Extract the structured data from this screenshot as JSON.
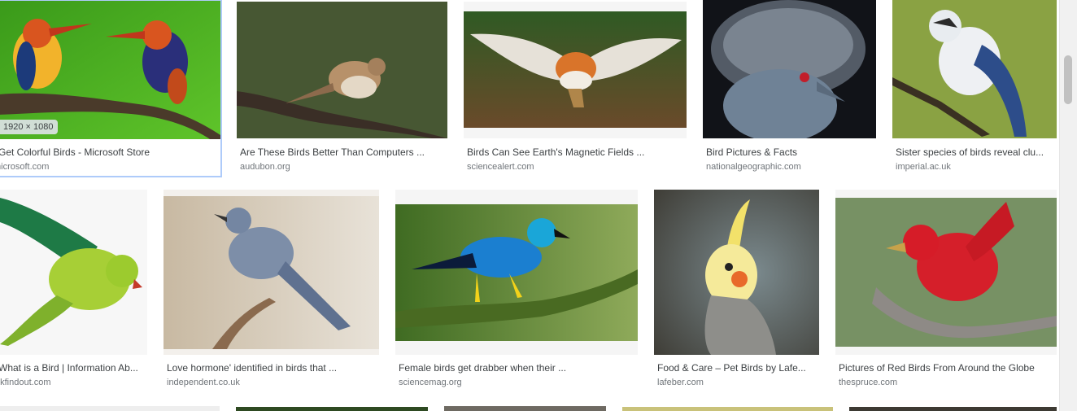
{
  "results": [
    {
      "caption": "Get Colorful Birds - Microsoft Store",
      "source": "microsoft.com",
      "dimensions": "1920 × 1080",
      "image_alt": "kingfisher-pair-photo"
    },
    {
      "caption": "Are These Birds Better Than Computers ...",
      "source": "audubon.org",
      "image_alt": "thrush-on-branch-photo"
    },
    {
      "caption": "Birds Can See Earth's Magnetic Fields ...",
      "source": "sciencealert.com",
      "image_alt": "robin-in-flight-photo"
    },
    {
      "caption": "Bird Pictures & Facts",
      "source": "nationalgeographic.com",
      "image_alt": "crowned-pigeon-photo"
    },
    {
      "caption": "Sister species of birds reveal clu...",
      "source": "imperial.ac.uk",
      "image_alt": "blue-white-bird-photo"
    },
    {
      "caption": "What is a Bird | Information Ab...",
      "source": "dkfindout.com",
      "image_alt": "green-parrot-photo"
    },
    {
      "caption": "Love hormone' identified in birds that ...",
      "source": "independent.co.uk",
      "image_alt": "grey-blue-bird-photo"
    },
    {
      "caption": "Female birds get drabber when their ...",
      "source": "sciencemag.org",
      "image_alt": "blue-honeycreeper-photo"
    },
    {
      "caption": "Food & Care – Pet Birds by Lafe...",
      "source": "lafeber.com",
      "image_alt": "cockatiel-photo"
    },
    {
      "caption": "Pictures of Red Birds From Around the Globe",
      "source": "thespruce.com",
      "image_alt": "red-tanager-photo"
    }
  ]
}
